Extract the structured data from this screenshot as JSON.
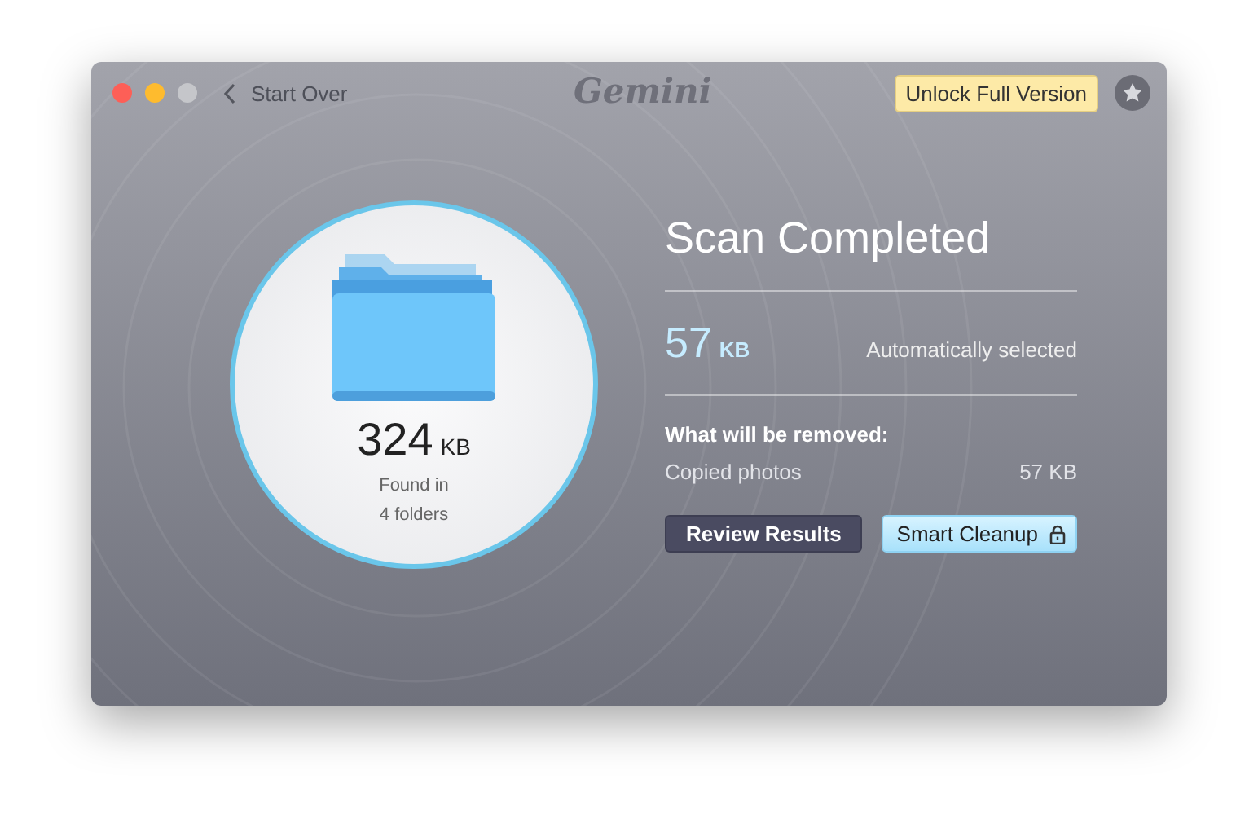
{
  "window": {
    "back_label": "Start Over",
    "logo": "Gemini",
    "upgrade_button": "Unlock Full Version"
  },
  "summary": {
    "size": "324",
    "unit": "KB",
    "line_1": "Found in",
    "line_2": "4 folders"
  },
  "result": {
    "title": "Scan Completed",
    "selected_size": "57",
    "selected_unit": "KB",
    "selected_note": "Automatically selected",
    "removed_heading": "What will be removed:",
    "items": [
      {
        "name": "Copied photos",
        "size": "57 KB"
      }
    ],
    "buttons": [
      {
        "label": "Review Results",
        "kind": "dark",
        "locked": false
      },
      {
        "label": "Smart Cleanup",
        "kind": "light",
        "locked": true
      }
    ]
  }
}
